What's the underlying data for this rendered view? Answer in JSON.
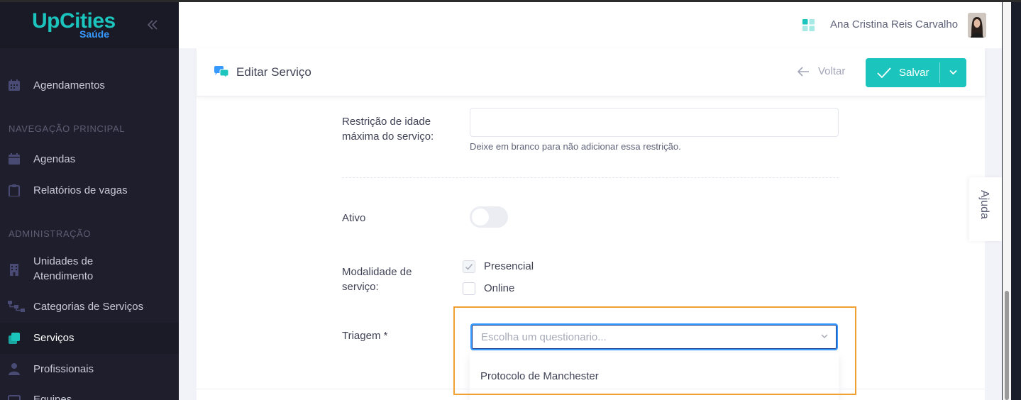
{
  "app": {
    "logo_main": "UpCities",
    "logo_sub": "Saúde"
  },
  "sidebar": {
    "items": [
      {
        "label": "Agendamentos",
        "icon": "calendar-grid-icon"
      },
      {
        "label": "Agendas",
        "icon": "calendar-icon"
      },
      {
        "label": "Relatórios de vagas",
        "icon": "clipboard-icon"
      },
      {
        "label": "Unidades de\nAtendimento",
        "icon": "building-icon"
      },
      {
        "label": "Categorias de Serviços",
        "icon": "hierarchy-icon"
      },
      {
        "label": "Serviços",
        "icon": "layers-icon",
        "active": true
      },
      {
        "label": "Profissionais",
        "icon": "user-icon"
      },
      {
        "label": "Equipes",
        "icon": "team-icon"
      }
    ],
    "sections": {
      "main": "NAVEGAÇÃO PRINCIPAL",
      "admin": "ADMINISTRAÇÃO"
    }
  },
  "header": {
    "user_name": "Ana Cristina Reis Carvalho"
  },
  "card": {
    "title": "Editar Serviço",
    "back_label": "Voltar",
    "save_label": "Salvar"
  },
  "form": {
    "max_age_label": "Restrição de idade máxima do serviço:",
    "max_age_value": "",
    "max_age_hint": "Deixe em branco para não adicionar essa restrição.",
    "active_label": "Ativo",
    "active": false,
    "modality_label": "Modalidade de serviço:",
    "modality_options": [
      {
        "label": "Presencial",
        "checked": true
      },
      {
        "label": "Online",
        "checked": false
      }
    ],
    "triage_label": "Triagem *",
    "triage_placeholder": "Escolha um questionario...",
    "triage_options": [
      "Protocolo de Manchester"
    ]
  },
  "help": {
    "label": "Ajuda"
  },
  "colors": {
    "accent": "#1bc5bd",
    "primary": "#3699ff",
    "sidebar_bg": "#1e1e2d",
    "highlight": "#f0a030"
  }
}
